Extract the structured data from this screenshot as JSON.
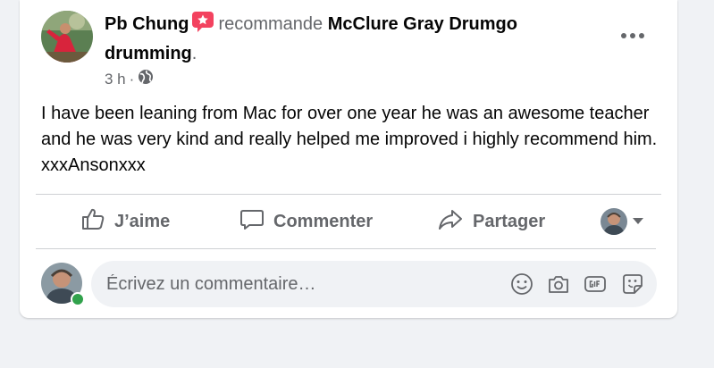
{
  "post": {
    "author": "Pb Chung",
    "recommends": "recommande",
    "page_name": "McClure Gray Drumgo drumming",
    "period": ".",
    "time": "3 h",
    "separator": "·",
    "body": "I have been leaning from Mac for over one year he was an awesome teacher and he was very kind and really helped me improved i highly recommend him.  xxxAnsonxxx",
    "audience_icon": "globe-icon",
    "recommend_icon": "recommend-star-icon"
  },
  "actions": {
    "like": "J’aime",
    "comment": "Commenter",
    "share": "Partager"
  },
  "composer": {
    "placeholder": "Écrivez un commentaire…",
    "icons": [
      "emoji-icon",
      "camera-icon",
      "gif-icon",
      "sticker-icon"
    ]
  },
  "colors": {
    "background": "#f0f2f5",
    "card": "#ffffff",
    "text_primary": "#050505",
    "text_secondary": "#65676b",
    "recommend_badge": "#f3425f",
    "online": "#31a24c"
  }
}
